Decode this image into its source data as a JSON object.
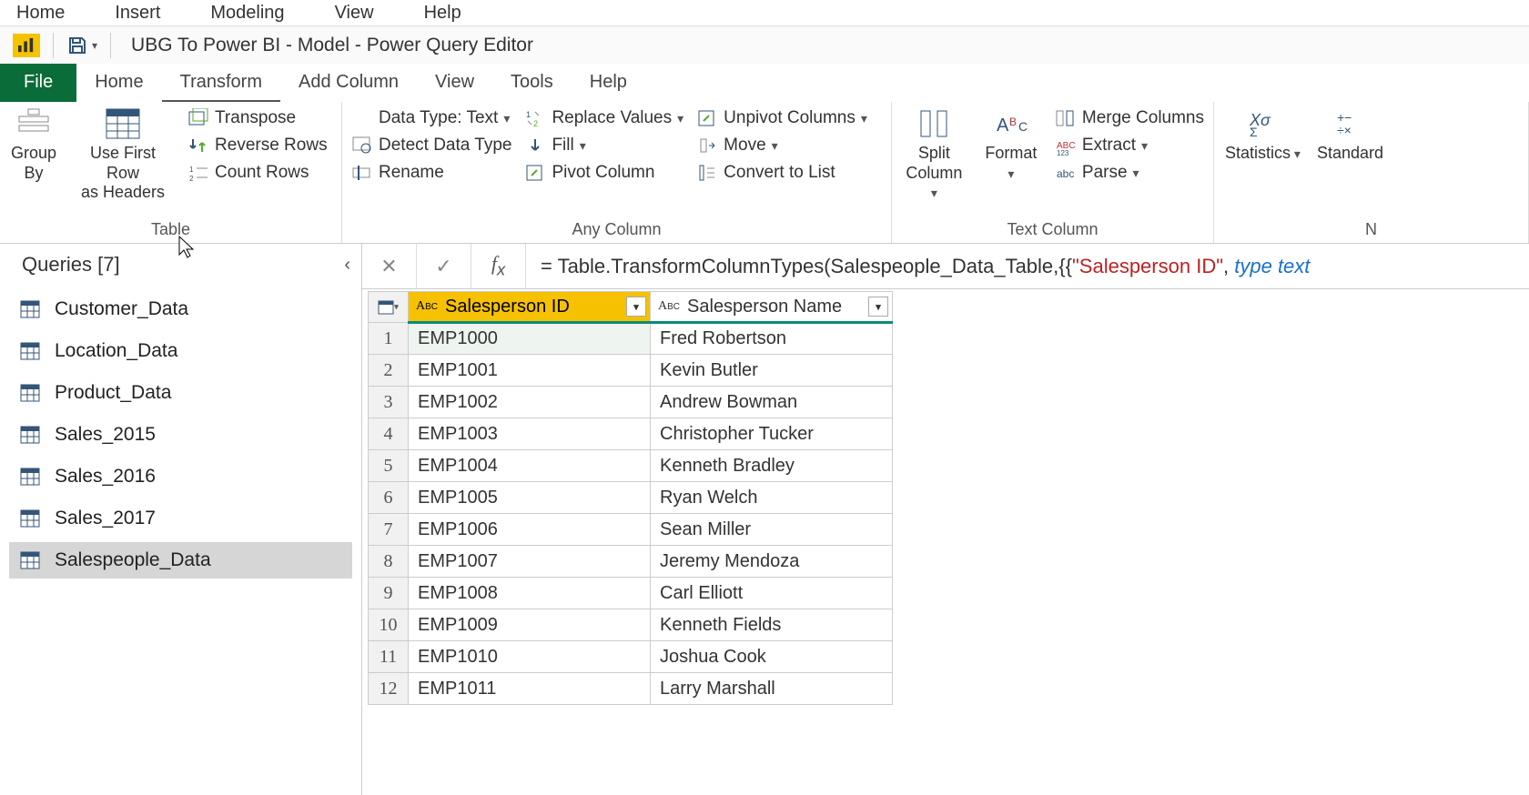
{
  "outer_menu": [
    "Home",
    "Insert",
    "Modeling",
    "View",
    "Help"
  ],
  "window_title": "UBG To Power BI - Model - Power Query Editor",
  "ribbon_tabs": {
    "file": "File",
    "items": [
      "Home",
      "Transform",
      "Add Column",
      "View",
      "Tools",
      "Help"
    ],
    "active_index": 1
  },
  "ribbon": {
    "table": {
      "group_label": "Table",
      "group_by": "Group\nBy",
      "first_row": "Use First Row\nas Headers",
      "transpose": "Transpose",
      "reverse": "Reverse Rows",
      "count": "Count Rows"
    },
    "any_column": {
      "group_label": "Any Column",
      "data_type": "Data Type: Text",
      "detect": "Detect Data Type",
      "rename": "Rename",
      "replace": "Replace Values",
      "fill": "Fill",
      "pivot": "Pivot Column",
      "unpivot": "Unpivot Columns",
      "move": "Move",
      "convert": "Convert to List"
    },
    "split_col": "Split\nColumn",
    "format": "Format",
    "text_column": {
      "group_label": "Text Column",
      "merge": "Merge Columns",
      "extract": "Extract",
      "parse": "Parse"
    },
    "stat_group": {
      "stats": "Statistics",
      "standard": "Standard",
      "group_label": "N"
    }
  },
  "queries": {
    "title": "Queries [7]",
    "items": [
      "Customer_Data",
      "Location_Data",
      "Product_Data",
      "Sales_2015",
      "Sales_2016",
      "Sales_2017",
      "Salespeople_Data"
    ],
    "selected_index": 6
  },
  "formula": {
    "prefix": "= ",
    "fn": "Table.TransformColumnTypes",
    "arg1": "Salespeople_Data_Table",
    "str": "\"Salesperson ID\"",
    "kw": "type text"
  },
  "grid": {
    "columns": [
      "Salesperson ID",
      "Salesperson Name"
    ],
    "selected_col": 0,
    "rows": [
      [
        "EMP1000",
        "Fred Robertson"
      ],
      [
        "EMP1001",
        "Kevin Butler"
      ],
      [
        "EMP1002",
        "Andrew Bowman"
      ],
      [
        "EMP1003",
        "Christopher Tucker"
      ],
      [
        "EMP1004",
        "Kenneth Bradley"
      ],
      [
        "EMP1005",
        "Ryan Welch"
      ],
      [
        "EMP1006",
        "Sean Miller"
      ],
      [
        "EMP1007",
        "Jeremy Mendoza"
      ],
      [
        "EMP1008",
        "Carl Elliott"
      ],
      [
        "EMP1009",
        "Kenneth Fields"
      ],
      [
        "EMP1010",
        "Joshua Cook"
      ],
      [
        "EMP1011",
        "Larry Marshall"
      ]
    ]
  }
}
